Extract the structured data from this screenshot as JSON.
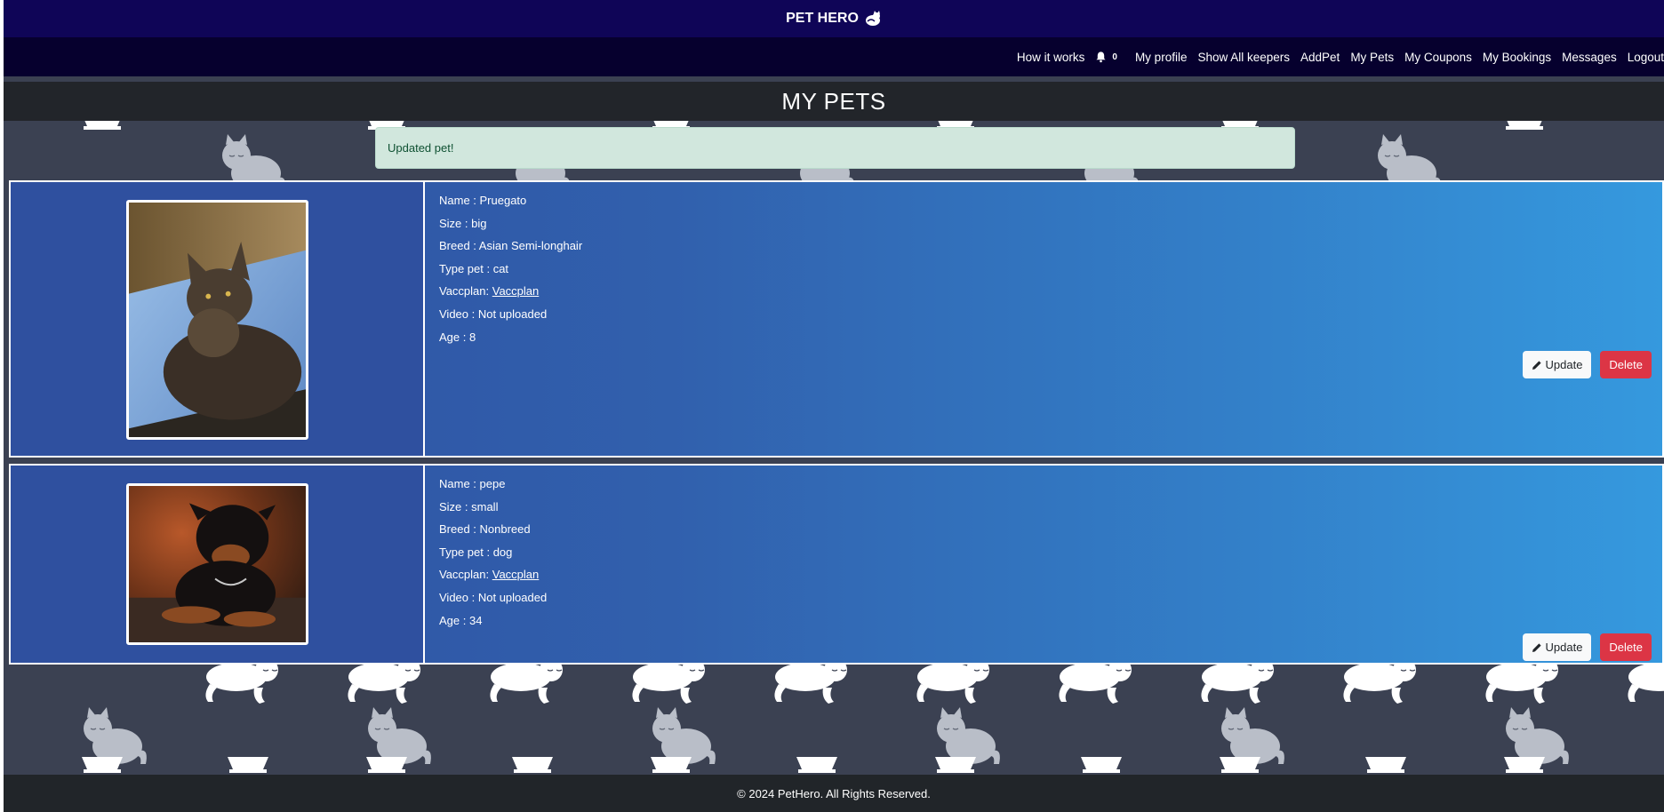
{
  "brand": {
    "name": "PET HERO",
    "icon": "cat-logo-icon"
  },
  "nav": {
    "how_it_works": "How it works",
    "notifications_count": "0",
    "my_profile": "My profile",
    "show_all_keepers": "Show All keepers",
    "add_pet": "AddPet",
    "my_pets": "My Pets",
    "my_coupons": "My Coupons",
    "my_bookings": "My Bookings",
    "messages": "Messages",
    "logout": "Logout"
  },
  "page_title": "MY PETS",
  "alert": "Updated pet!",
  "pets": [
    {
      "name": "Name : Pruegato",
      "size": "Size : big",
      "breed": "Breed : Asian Semi-longhair",
      "type": "Type pet : cat",
      "vacc_label": "Vaccplan: ",
      "vacc_link": "Vaccplan",
      "video": "Video : Not uploaded",
      "age": "Age : 8",
      "update_label": "Update",
      "delete_label": "Delete"
    },
    {
      "name": "Name : pepe",
      "size": "Size : small",
      "breed": "Breed : Nonbreed",
      "type": "Type pet : dog",
      "vacc_label": "Vaccplan: ",
      "vacc_link": "Vaccplan",
      "video": "Video : Not uploaded",
      "age": "Age : 34",
      "update_label": "Update",
      "delete_label": "Delete"
    }
  ],
  "footer": "© 2024 PetHero. All Rights Reserved.",
  "colors": {
    "topbar": "#0f0557",
    "navbar": "#06002e",
    "title_bar": "#22252a",
    "alert_bg": "#d1e7dd",
    "card_start": "#2e4ea0",
    "card_end": "#3599de",
    "delete": "#dc3545"
  }
}
